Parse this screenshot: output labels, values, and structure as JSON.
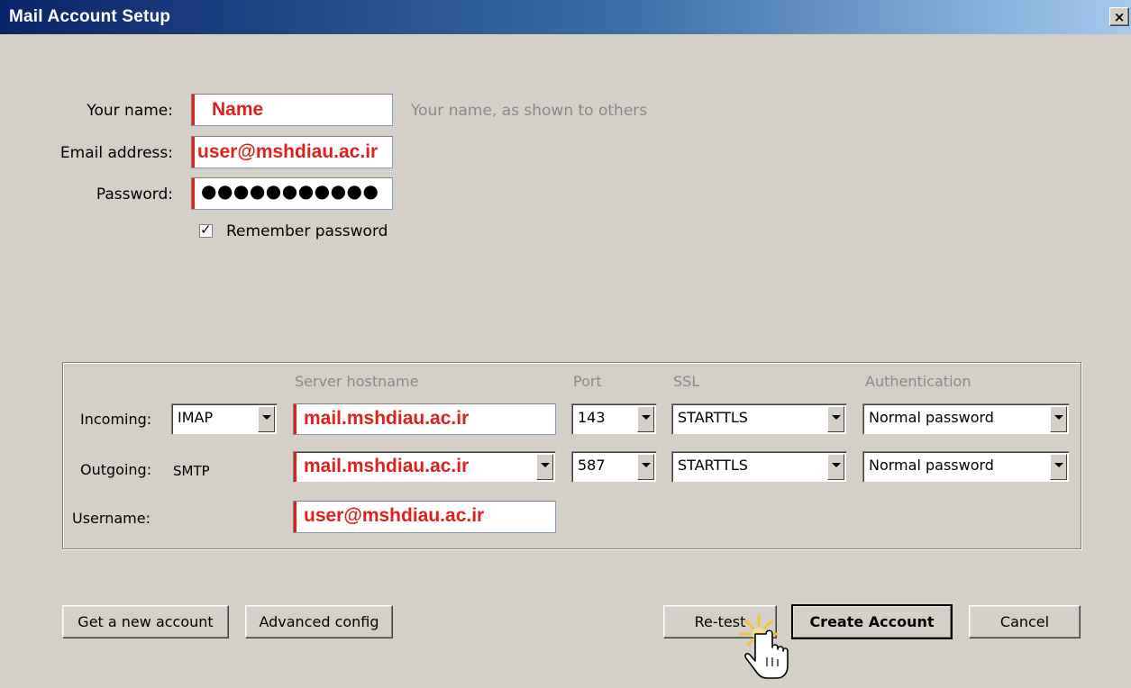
{
  "window": {
    "title": "Mail Account Setup",
    "close_label": "×"
  },
  "identity": {
    "name_label": "Your name:",
    "name_value": "Name",
    "name_hint": "Your name, as shown to others",
    "email_label": "Email address:",
    "email_value": "user@mshdiau.ac.ir",
    "password_label": "Password:",
    "password_value": "●●●●●●●●●●●",
    "remember_label": "Remember password",
    "remember_checked": true
  },
  "server": {
    "headers": {
      "hostname": "Server hostname",
      "port": "Port",
      "ssl": "SSL",
      "auth": "Authentication"
    },
    "incoming": {
      "label": "Incoming:",
      "protocol": "IMAP",
      "hostname": "mail.mshdiau.ac.ir",
      "port": "143",
      "ssl": "STARTTLS",
      "auth": "Normal password"
    },
    "outgoing": {
      "label": "Outgoing:",
      "protocol": "SMTP",
      "hostname": "mail.mshdiau.ac.ir",
      "port": "587",
      "ssl": "STARTTLS",
      "auth": "Normal password"
    },
    "username": {
      "label": "Username:",
      "value": "user@mshdiau.ac.ir"
    }
  },
  "buttons": {
    "get_new_account": "Get a new account",
    "advanced_config": "Advanced config",
    "retest": "Re-test",
    "create_account": "Create Account",
    "cancel": "Cancel"
  },
  "colors": {
    "highlight_red": "#e0201a",
    "dialog_bg": "#d4d0c8",
    "title_blue": "#0a246a"
  }
}
